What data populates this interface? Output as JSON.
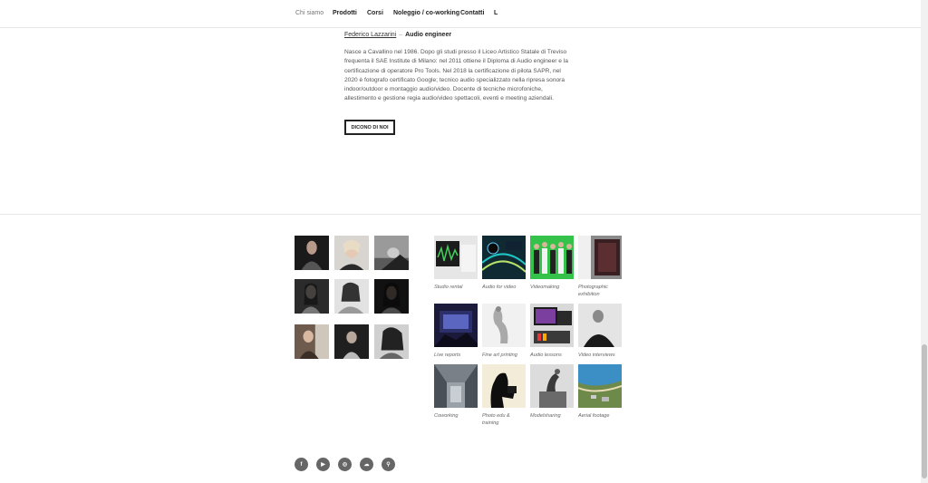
{
  "nav": {
    "items": [
      "Chi siamo",
      "Prodotti",
      "Corsi",
      "Noleggio / co-working",
      "Contatti",
      "L"
    ]
  },
  "author": {
    "name": "Federico Lazzarini",
    "separator": "–",
    "role": "Audio engineer",
    "bio": "Nasce a Cavallino nel 1986. Dopo gli studi presso il Liceo Artistico Statale di Treviso frequenta il SAE Institute di Milano: nel 2011 ottiene il Diploma di Audio engineer e la certificazione di operatore Pro Tools. Nel 2018 la certificazione di pilota SAPR, nel 2020 è fotografo certificato Google; tecnico audio specializzato nella ripresa sonora indoor/outdoor e montaggio audio/video. Docente di tecniche microfoniche, allestimento e gestione regia audio/video spettacoli, eventi e meeting aziendali."
  },
  "cta": {
    "label": "DICONO DI NOI"
  },
  "services": [
    {
      "caption": "Studio rental",
      "icon": "studio-rental-photo"
    },
    {
      "caption": "Audio for video",
      "icon": "audio-for-video-photo"
    },
    {
      "caption": "Videomaking",
      "icon": "videomaking-photo"
    },
    {
      "caption": "Photographic exhibition",
      "icon": "photographic-exhibition-photo"
    },
    {
      "caption": "Live reports",
      "icon": "live-reports-photo"
    },
    {
      "caption": "Fine art printing",
      "icon": "fine-art-printing-photo"
    },
    {
      "caption": "Audio lessons",
      "icon": "audio-lessons-photo"
    },
    {
      "caption": "Video interviews",
      "icon": "video-interviews-photo"
    },
    {
      "caption": "Coworking",
      "icon": "coworking-photo"
    },
    {
      "caption": "Photo edu & training",
      "icon": "photo-edu-photo"
    },
    {
      "caption": "Modelsharing",
      "icon": "modelsharing-photo"
    },
    {
      "caption": "Aerial footage",
      "icon": "aerial-footage-photo"
    }
  ],
  "portfolio": [
    "portrait-photo",
    "portrait-photo",
    "portrait-photo",
    "portrait-photo",
    "portrait-photo",
    "portrait-photo",
    "portrait-photo",
    "portrait-photo",
    "portrait-photo"
  ],
  "social": [
    {
      "label": "f",
      "icon": "facebook-icon"
    },
    {
      "label": "▶",
      "icon": "youtube-icon"
    },
    {
      "label": "◎",
      "icon": "instagram-icon"
    },
    {
      "label": "☁",
      "icon": "soundcloud-icon"
    },
    {
      "label": "⚲",
      "icon": "link-icon"
    }
  ],
  "colors": {
    "text": "#333333",
    "muted": "#777777",
    "social_bg": "#666666",
    "divider": "#e8e8e8"
  }
}
